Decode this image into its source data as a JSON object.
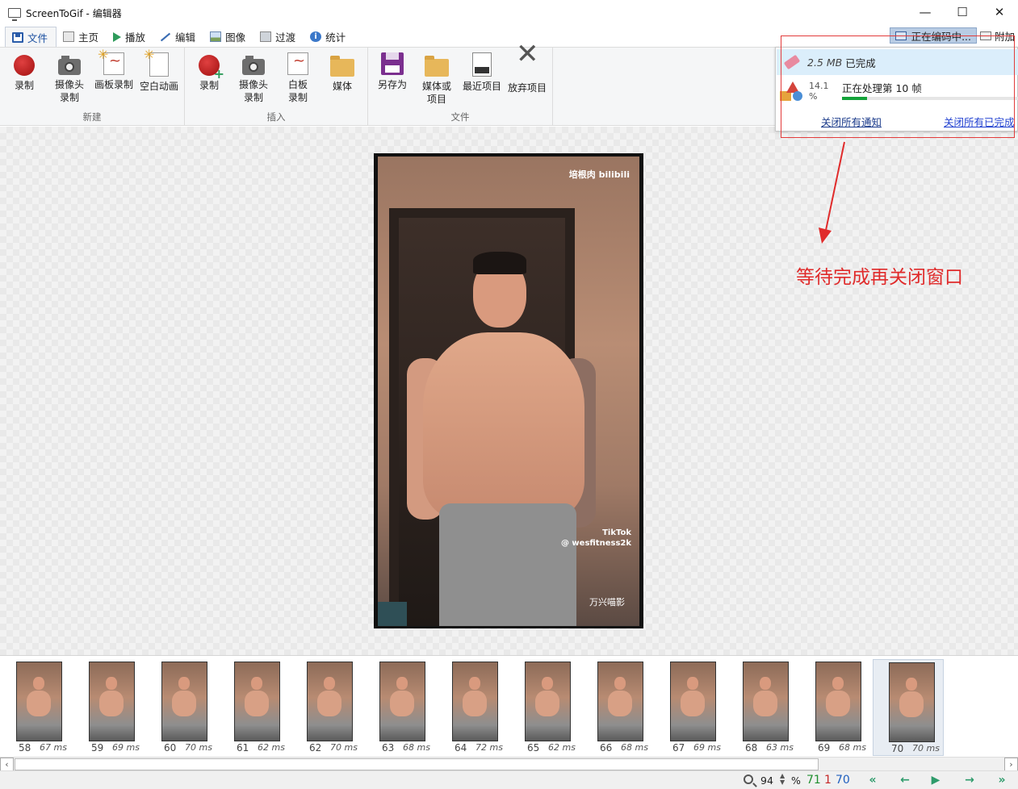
{
  "window": {
    "title": "ScreenToGif - 编辑器",
    "minimize": "—",
    "maximize": "☐",
    "close": "✕"
  },
  "tabs": [
    {
      "label": "文件",
      "icon": "save-icon",
      "active": true
    },
    {
      "label": "主页",
      "icon": "home-icon"
    },
    {
      "label": "播放",
      "icon": "play-icon"
    },
    {
      "label": "编辑",
      "icon": "pencil-icon"
    },
    {
      "label": "图像",
      "icon": "image-icon"
    },
    {
      "label": "过渡",
      "icon": "transition-icon"
    },
    {
      "label": "统计",
      "icon": "info-icon"
    }
  ],
  "top_right": {
    "encoding_label": "正在编码中...",
    "attach_label": "附加"
  },
  "ribbon": {
    "new_group": {
      "title": "新建",
      "buttons": [
        "录制",
        "摄像头\n录制",
        "画板录制",
        "空白动画"
      ]
    },
    "insert_group": {
      "title": "插入",
      "buttons": [
        "录制",
        "摄像头\n录制",
        "白板\n录制",
        "媒体"
      ]
    },
    "file_group": {
      "title": "文件",
      "buttons": [
        "另存为",
        "媒体或\n项目",
        "最近项目",
        "放弃项目"
      ]
    }
  },
  "notification": {
    "finished_size": "2.5 MB",
    "finished_label": "已完成",
    "progress_percent": "14.1 %",
    "progress_fraction": 0.141,
    "processing_label": "正在处理第 10 帧",
    "close_all_label": "关闭所有通知",
    "close_finished_label": "关闭所有已完成"
  },
  "preview": {
    "watermark_top": "培根肉 bilibili",
    "watermark_tiktok": "TikTok",
    "watermark_handle": "@ wesfitness2k",
    "watermark_bottom": "万兴喵影"
  },
  "annotation": {
    "text": "等待完成再关闭窗口",
    "color": "#e02b2b"
  },
  "frames": [
    {
      "num": "58",
      "ms": "67 ms"
    },
    {
      "num": "59",
      "ms": "69 ms"
    },
    {
      "num": "60",
      "ms": "70 ms"
    },
    {
      "num": "61",
      "ms": "62 ms"
    },
    {
      "num": "62",
      "ms": "70 ms"
    },
    {
      "num": "63",
      "ms": "68 ms"
    },
    {
      "num": "64",
      "ms": "72 ms"
    },
    {
      "num": "65",
      "ms": "62 ms"
    },
    {
      "num": "66",
      "ms": "68 ms"
    },
    {
      "num": "67",
      "ms": "69 ms"
    },
    {
      "num": "68",
      "ms": "63 ms"
    },
    {
      "num": "69",
      "ms": "68 ms"
    },
    {
      "num": "70",
      "ms": "70 ms",
      "selected": true
    }
  ],
  "statusbar": {
    "zoom_value": "94",
    "zoom_unit": "%",
    "count_green": "71",
    "count_red": "1",
    "count_blue": "70"
  }
}
